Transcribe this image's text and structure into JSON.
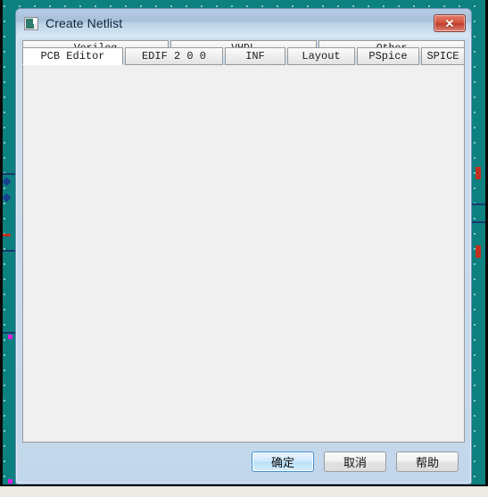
{
  "dialog": {
    "title": "Create Netlist",
    "icon": "window-document-icon",
    "close_label": "✕"
  },
  "tabs": {
    "row_top": [
      {
        "label": "Verilog",
        "active": false
      },
      {
        "label": "VHDL",
        "active": false
      },
      {
        "label": "Other",
        "active": false
      }
    ],
    "row_bottom": [
      {
        "label": "PCB Editor",
        "active": true
      },
      {
        "label": "EDIF 2 0 0",
        "active": false
      },
      {
        "label": "INF",
        "active": false
      },
      {
        "label": "Layout",
        "active": false
      },
      {
        "label": "PSpice",
        "active": false
      },
      {
        "label": "SPICE",
        "active": false
      }
    ],
    "active_tab": "PCB Editor"
  },
  "footer": {
    "ok_label": "确定",
    "cancel_label": "取消",
    "help_label": "帮助"
  },
  "colors": {
    "titlebar_blue": "#a7c1dc",
    "dialog_bg": "#c9dbee",
    "canvas_teal": "#0d8080",
    "close_red": "#c03e2c",
    "default_button_blue": "#3f8fd0",
    "panel_gray": "#f0f0f0"
  }
}
